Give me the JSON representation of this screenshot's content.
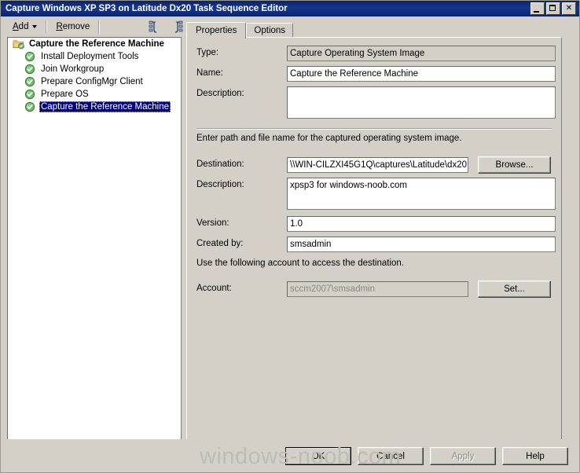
{
  "window": {
    "title": "Capture Windows XP SP3 on Latitude Dx20 Task Sequence Editor",
    "minimize_label": "_",
    "maximize_label": "□",
    "close_label": "✕"
  },
  "toolbar": {
    "add_label": "Add",
    "remove_label": "Remove",
    "move_up_icon": "move-up-icon",
    "move_down_icon": "move-down-icon"
  },
  "tree": {
    "root": {
      "label": "Capture the Reference Machine",
      "icon": "folder-check-icon"
    },
    "items": [
      {
        "label": "Install Deployment Tools",
        "icon": "green-check-icon",
        "selected": false
      },
      {
        "label": "Join Workgroup",
        "icon": "green-check-icon",
        "selected": false
      },
      {
        "label": "Prepare ConfigMgr Client",
        "icon": "green-check-icon",
        "selected": false
      },
      {
        "label": "Prepare OS",
        "icon": "green-check-icon",
        "selected": false
      },
      {
        "label": "Capture the Reference Machine",
        "icon": "green-check-icon",
        "selected": true
      }
    ]
  },
  "tabs": [
    {
      "label": "Properties",
      "active": true
    },
    {
      "label": "Options",
      "active": false
    }
  ],
  "properties": {
    "type_label": "Type:",
    "type_value": "Capture Operating System Image",
    "name_label": "Name:",
    "name_value": "Capture the Reference Machine",
    "description_label": "Description:",
    "description_value": "",
    "path_hint": "Enter path and file name for the captured operating system image.",
    "destination_label": "Destination:",
    "destination_value": "\\\\WIN-CILZXI45G1Q\\captures\\Latitude\\dx20",
    "browse_label": "Browse...",
    "image_description_label": "Description:",
    "image_description_value": "xpsp3 for windows-noob.com",
    "version_label": "Version:",
    "version_value": "1.0",
    "created_by_label": "Created by:",
    "created_by_value": "smsadmin",
    "account_hint": "Use the following account to access the destination.",
    "account_label": "Account:",
    "account_value": "sccm2007\\smsadmin",
    "set_label": "Set..."
  },
  "footer": {
    "ok_label": "OK",
    "cancel_label": "Cancel",
    "apply_label": "Apply",
    "help_label": "Help",
    "watermark": "windows-noob.com"
  },
  "colors": {
    "titlebar": "#0a246a",
    "selection": "#000080",
    "face": "#d4d0c8",
    "check_green": "#3a9e3a",
    "watermark": "#bdbdb5"
  }
}
